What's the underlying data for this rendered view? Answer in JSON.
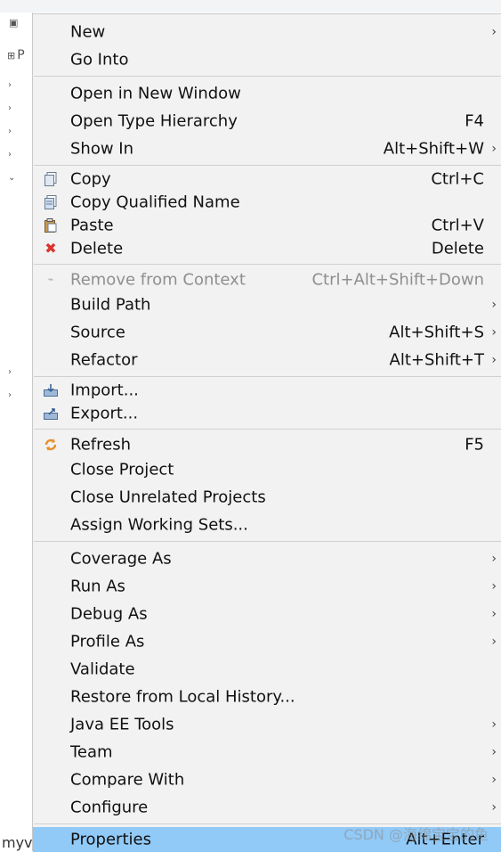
{
  "menu": {
    "items": [
      {
        "label": "New",
        "accel": "",
        "submenu": true,
        "icon": ""
      },
      {
        "label": "Go Into",
        "accel": "",
        "submenu": false,
        "icon": ""
      },
      {
        "label": "Open in New Window",
        "accel": "",
        "submenu": false,
        "icon": ""
      },
      {
        "label": "Open Type Hierarchy",
        "accel": "F4",
        "submenu": false,
        "icon": ""
      },
      {
        "label": "Show In",
        "accel": "Alt+Shift+W",
        "submenu": true,
        "icon": ""
      },
      {
        "label": "Copy",
        "accel": "Ctrl+C",
        "submenu": false,
        "icon": "copy-icon"
      },
      {
        "label": "Copy Qualified Name",
        "accel": "",
        "submenu": false,
        "icon": "copy-qualified-name-icon"
      },
      {
        "label": "Paste",
        "accel": "Ctrl+V",
        "submenu": false,
        "icon": "paste-icon"
      },
      {
        "label": "Delete",
        "accel": "Delete",
        "submenu": false,
        "icon": "delete-icon"
      },
      {
        "label": "Remove from Context",
        "accel": "Ctrl+Alt+Shift+Down",
        "submenu": false,
        "icon": "remove-from-context-icon",
        "disabled": true
      },
      {
        "label": "Build Path",
        "accel": "",
        "submenu": true,
        "icon": ""
      },
      {
        "label": "Source",
        "accel": "Alt+Shift+S",
        "submenu": true,
        "icon": ""
      },
      {
        "label": "Refactor",
        "accel": "Alt+Shift+T",
        "submenu": true,
        "icon": ""
      },
      {
        "label": "Import...",
        "accel": "",
        "submenu": false,
        "icon": "import-icon"
      },
      {
        "label": "Export...",
        "accel": "",
        "submenu": false,
        "icon": "export-icon"
      },
      {
        "label": "Refresh",
        "accel": "F5",
        "submenu": false,
        "icon": "refresh-icon"
      },
      {
        "label": "Close Project",
        "accel": "",
        "submenu": false,
        "icon": ""
      },
      {
        "label": "Close Unrelated Projects",
        "accel": "",
        "submenu": false,
        "icon": ""
      },
      {
        "label": "Assign Working Sets...",
        "accel": "",
        "submenu": false,
        "icon": ""
      },
      {
        "label": "Coverage As",
        "accel": "",
        "submenu": true,
        "icon": ""
      },
      {
        "label": "Run As",
        "accel": "",
        "submenu": true,
        "icon": ""
      },
      {
        "label": "Debug As",
        "accel": "",
        "submenu": true,
        "icon": ""
      },
      {
        "label": "Profile As",
        "accel": "",
        "submenu": true,
        "icon": ""
      },
      {
        "label": "Validate",
        "accel": "",
        "submenu": false,
        "icon": ""
      },
      {
        "label": "Restore from Local History...",
        "accel": "",
        "submenu": false,
        "icon": ""
      },
      {
        "label": "Java EE Tools",
        "accel": "",
        "submenu": true,
        "icon": ""
      },
      {
        "label": "Team",
        "accel": "",
        "submenu": true,
        "icon": ""
      },
      {
        "label": "Compare With",
        "accel": "",
        "submenu": true,
        "icon": ""
      },
      {
        "label": "Configure",
        "accel": "",
        "submenu": true,
        "icon": ""
      },
      {
        "label": "Properties",
        "accel": "Alt+Enter",
        "submenu": false,
        "icon": "",
        "selected": true
      }
    ]
  },
  "background": {
    "pane_tab_label": "P",
    "bottom_text": "myv"
  },
  "watermark": "CSDN @海绵宝宝的鱼",
  "colors": {
    "menu_bg": "#f2f2f2",
    "selected_bg": "#91c9f7",
    "disabled_text": "#8f8f8f",
    "delete_red": "#d9342b",
    "refresh_orange": "#e8912b"
  }
}
